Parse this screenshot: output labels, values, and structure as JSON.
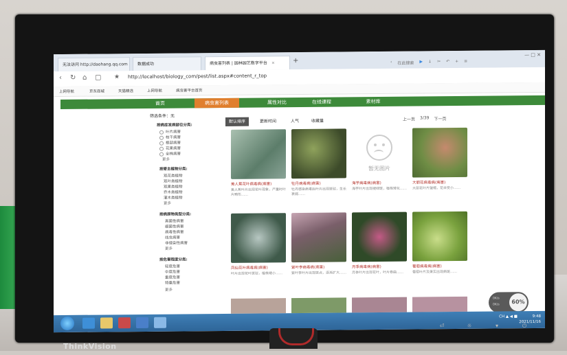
{
  "browser": {
    "tabs": [
      {
        "label": "无法访问 http://daohang.qq.com",
        "active": false
      },
      {
        "label": "数据成功",
        "active": false
      },
      {
        "label": "病虫害列表 | 园林园艺数字平台",
        "active": true
      }
    ],
    "new_tab": "+",
    "window_controls": "—  □  ✕",
    "url": "http://localhost/biology_com/pest/list.aspx#content_r_top",
    "search_placeholder": "在此搜索",
    "bookmarks": [
      "上网导航",
      "京东商城",
      "天猫精选",
      "上网导航",
      "病虫害平台首页"
    ]
  },
  "site": {
    "nav": [
      {
        "label": "首页",
        "active": false
      },
      {
        "label": "病虫害列表",
        "active": true
      },
      {
        "label": "属性对比",
        "active": false
      },
      {
        "label": "在线课程",
        "active": false
      },
      {
        "label": "素材库",
        "active": false
      }
    ],
    "filter_label": "筛选条件：无",
    "sidebar": {
      "groups": [
        {
          "title": "按病症发病部位分类:",
          "items": [
            "叶片病害",
            "枝干病害",
            "根部病害",
            "花果病害",
            "全株病害"
          ],
          "more": "更多"
        },
        {
          "title": "按寄主植物分类:",
          "items": [
            "观花类植物",
            "观叶类植物",
            "观果类植物",
            "乔木类植物",
            "灌木类植物"
          ],
          "more": "更多"
        },
        {
          "title": "按病原物类型分类:",
          "items": [
            "真菌性病害",
            "细菌性病害",
            "病毒性病害",
            "线虫病害",
            "非侵染性病害"
          ],
          "more": "更多"
        },
        {
          "title": "按危害程度分类:",
          "items": [
            "轻度危害",
            "中度危害",
            "重度危害",
            "特重危害"
          ],
          "more": "更多"
        }
      ]
    },
    "sort": [
      {
        "label": "默认排序",
        "active": true
      },
      {
        "label": "更新时间",
        "active": false
      },
      {
        "label": "人气",
        "active": false
      },
      {
        "label": "收藏量",
        "active": false
      }
    ],
    "pager": {
      "prev": "上一页",
      "page": "3/39",
      "next": "下一页"
    },
    "cards": [
      {
        "title": "美人蕉花叶病毒病(病害)",
        "desc": "美人蕉叶片出现花叶现象，严重时叶片畸形……",
        "color": "#7e9a88"
      },
      {
        "title": "牡丹病毒病(病害)",
        "desc": "牡丹感染病毒后叶片出现斑驳，生长衰弱……",
        "color": "#56663d"
      },
      {
        "title": "海芋病毒病(病害)",
        "desc": "海芋叶片出现褪绿斑，植株矮化……",
        "color": "#ffffff",
        "noimage": "暂无图片"
      },
      {
        "title": "大丽花病毒病(病害)",
        "desc": "大丽花叶片皱缩，花朵变小……",
        "color": "#79985a"
      },
      {
        "title": "凤仙花叶病毒病(病害)",
        "desc": "叶片出现花叶斑驳，植株矮小……",
        "color": "#6e7f7a"
      },
      {
        "title": "紫叶李病毒病(病害)",
        "desc": "紫叶李叶片出现斑点，逐渐扩大……",
        "color": "#9b6f7a"
      },
      {
        "title": "月季病毒病(病害)",
        "desc": "月季叶片出现花叶，叶片卷曲……",
        "color": "#3c5e32"
      },
      {
        "title": "葡萄病毒病(病害)",
        "desc": "葡萄叶片及果实出现病斑……",
        "color": "#8bb04a"
      }
    ],
    "widget": {
      "percent": "60%",
      "up": "0K/s",
      "down": "0K/s"
    }
  },
  "taskbar": {
    "time": "9:48",
    "date": "2021/11/16",
    "tray": "CH ▲ ◀ ■"
  },
  "monitor": {
    "brand": "ThinkVision"
  }
}
